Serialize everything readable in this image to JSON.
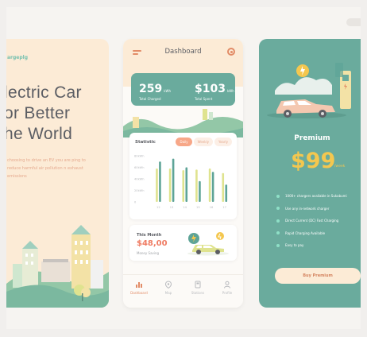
{
  "left": {
    "brand": "argeplg",
    "headline": [
      "lectric Car",
      "or Better",
      "he World"
    ],
    "blurb": "choosing to drive an EV you are ping to reduce harmful air pollution n exhaust emissions"
  },
  "dashboard": {
    "title": "Dashboard",
    "stats": [
      {
        "value": "259",
        "unit": "kWh",
        "label": "Total Charged"
      },
      {
        "value": "$103",
        "unit": "kWh",
        "label": "Total Spent"
      }
    ],
    "statistic": {
      "title": "Statistic",
      "tabs": [
        "Daily",
        "Weekly",
        "Yearly"
      ],
      "active_tab": 0
    },
    "this_month": {
      "title": "This Month",
      "value": "$48,00",
      "label": "Money Saving"
    },
    "nav": [
      {
        "label": "Dashboard",
        "icon": "chart-icon",
        "active": true
      },
      {
        "label": "Map",
        "icon": "map-pin-icon",
        "active": false
      },
      {
        "label": "Stations",
        "icon": "station-icon",
        "active": false
      },
      {
        "label": "Profile",
        "icon": "user-icon",
        "active": false
      }
    ]
  },
  "chart_data": {
    "type": "bar",
    "title": "Statistic",
    "categories": [
      "12",
      "13",
      "14",
      "15",
      "16",
      "17"
    ],
    "y_tick_labels": [
      "80kWh",
      "60kWh",
      "40kWh",
      "20kWh",
      "0"
    ],
    "ylim": [
      0,
      80
    ],
    "grid": false,
    "series": [
      {
        "color": "#dfe38f",
        "values": [
          58,
          58,
          55,
          56,
          58,
          50
        ]
      },
      {
        "color": "#5ea497",
        "values": [
          70,
          75,
          60,
          36,
          52,
          30
        ]
      }
    ]
  },
  "premium": {
    "title": "Premium",
    "price": "$99",
    "period": "/week",
    "features": [
      "1000+ chargers available in Sukabumi",
      "Use any in-network charger",
      "Direct Current (DC) Fast Charging",
      "Rapid Charging Available",
      "Easy to pay"
    ],
    "cta": "Buy Premium"
  },
  "colors": {
    "accent": "#e28c67",
    "teal": "#6aab9d",
    "cream": "#fcebd6",
    "gold": "#f4c74f"
  }
}
